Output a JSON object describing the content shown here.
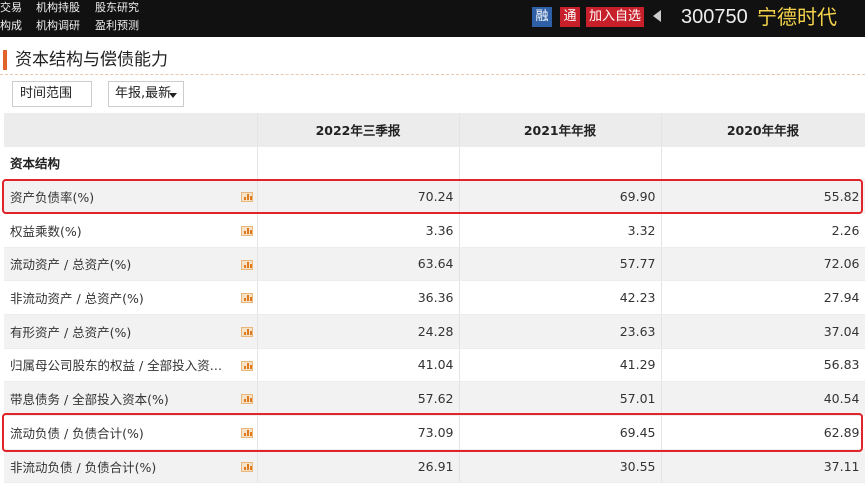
{
  "nav": {
    "row1": [
      "交易",
      "机构持股",
      "股东研究"
    ],
    "row2": [
      "构成",
      "机构调研",
      "盈利预测"
    ]
  },
  "header": {
    "rong_label": "融",
    "tong_label": "通",
    "add_watch_label": "加入自选",
    "stock_code": "300750",
    "stock_name": "宁德时代"
  },
  "section": {
    "title": "资本结构与偿债能力"
  },
  "filters": {
    "time_range_label": "时间范围",
    "period_value": "年报,最新"
  },
  "table": {
    "columns": [
      "2022年三季报",
      "2021年年报",
      "2020年年报"
    ],
    "group_label": "资本结构",
    "rows": [
      {
        "label": "资产负债率(%)",
        "values": [
          "70.24",
          "69.90",
          "55.82"
        ],
        "highlighted": true
      },
      {
        "label": "权益乘数(%)",
        "values": [
          "3.36",
          "3.32",
          "2.26"
        ]
      },
      {
        "label": "流动资产 / 总资产(%)",
        "values": [
          "63.64",
          "57.77",
          "72.06"
        ]
      },
      {
        "label": "非流动资产 / 总资产(%)",
        "values": [
          "36.36",
          "42.23",
          "27.94"
        ]
      },
      {
        "label": "有形资产 / 总资产(%)",
        "values": [
          "24.28",
          "23.63",
          "37.04"
        ]
      },
      {
        "label": "归属母公司股东的权益 / 全部投入资本(...",
        "values": [
          "41.04",
          "41.29",
          "56.83"
        ]
      },
      {
        "label": "带息债务 / 全部投入资本(%)",
        "values": [
          "57.62",
          "57.01",
          "40.54"
        ]
      },
      {
        "label": "流动负债 / 负债合计(%)",
        "values": [
          "73.09",
          "69.45",
          "62.89"
        ],
        "highlighted": true
      },
      {
        "label": "非流动负债 / 负债合计(%)",
        "values": [
          "26.91",
          "30.55",
          "37.11"
        ]
      }
    ]
  },
  "colors": {
    "topbar": "#111111",
    "accent_orange": "#e0642a",
    "highlight_red": "#e0242a",
    "stock_name_yellow": "#f5d24b",
    "rong_blue": "#2f5fa7"
  }
}
